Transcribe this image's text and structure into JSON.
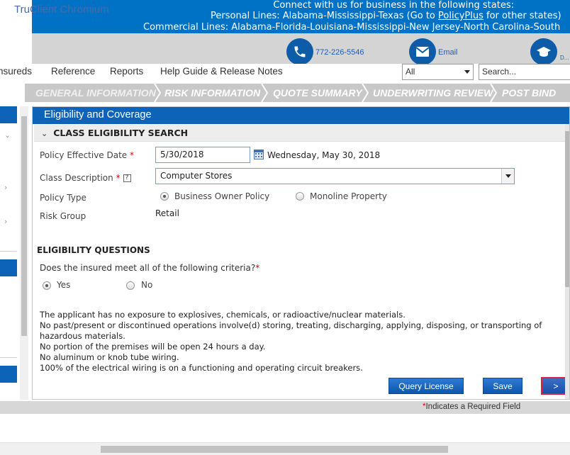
{
  "app": {
    "title": "TruClient Chromium"
  },
  "banner": {
    "line1": "Connect with us for business in the following states:",
    "line2_prefix": "Personal Lines: Alabama-Mississippi-Texas (Go to ",
    "line2_link": "PolicyPlus",
    "line2_suffix": " for other states)",
    "line3": "Commercial Lines: Alabama-Florida-Louisiana-Mississippi-New Jersey-North Carolina-South"
  },
  "contact": {
    "phone_number": "772-226-5546",
    "email_label": "Email",
    "third_label": "D..."
  },
  "nav": {
    "items": [
      "nsureds",
      "Reference",
      "Reports",
      "Help Guide & Release Notes"
    ],
    "filter_value": "All",
    "search_placeholder": "Search..."
  },
  "steps": [
    "GENERAL INFORMATION",
    "RISK INFORMATION",
    "QUOTE SUMMARY",
    "UNDERWRITING REVIEW",
    "POST BIND"
  ],
  "panel": {
    "title": "Eligibility and Coverage",
    "section_title": "CLASS ELIGIBILITY SEARCH",
    "effective_date_label": "Policy Effective Date",
    "effective_date_value": "5/30/2018",
    "effective_date_long": "Wednesday, May 30, 2018",
    "class_description_label": "Class Description",
    "class_description_value": "Computer Stores",
    "policy_type_label": "Policy Type",
    "policy_type_options": [
      "Business Owner Policy",
      "Monoline Property"
    ],
    "policy_type_selected": "Business Owner Policy",
    "risk_group_label": "Risk Group",
    "risk_group_value": "Retail",
    "required_mark": "*",
    "help_glyph": "?"
  },
  "eligibility": {
    "title": "ELIGIBILITY QUESTIONS",
    "question": "Does the insured meet all of the following criteria?",
    "options": [
      "Yes",
      "No"
    ],
    "selected": "Yes",
    "criteria": [
      "The applicant has no exposure to explosives, chemicals, or radioactive/nuclear materials.",
      "No past/present or discontinued operations involve(d) storing, treating, discharging, applying, disposing, or transporting of hazardous materials.",
      "No portion of the premises will be open 24 hours a day.",
      "No aluminum or knob tube wiring.",
      "100% of the electrical wiring is on a functioning and operating circuit breakers."
    ]
  },
  "buttons": {
    "query_license": "Query License",
    "save": "Save",
    "next": ">"
  },
  "footer": {
    "required_mark": "*",
    "required_note": "Indicates a Required Field"
  },
  "colors": {
    "brand_blue": "#0072c6",
    "header_blue": "#0d63b8",
    "step_bar": "#c8c8c8",
    "required_red": "#dd0000"
  }
}
